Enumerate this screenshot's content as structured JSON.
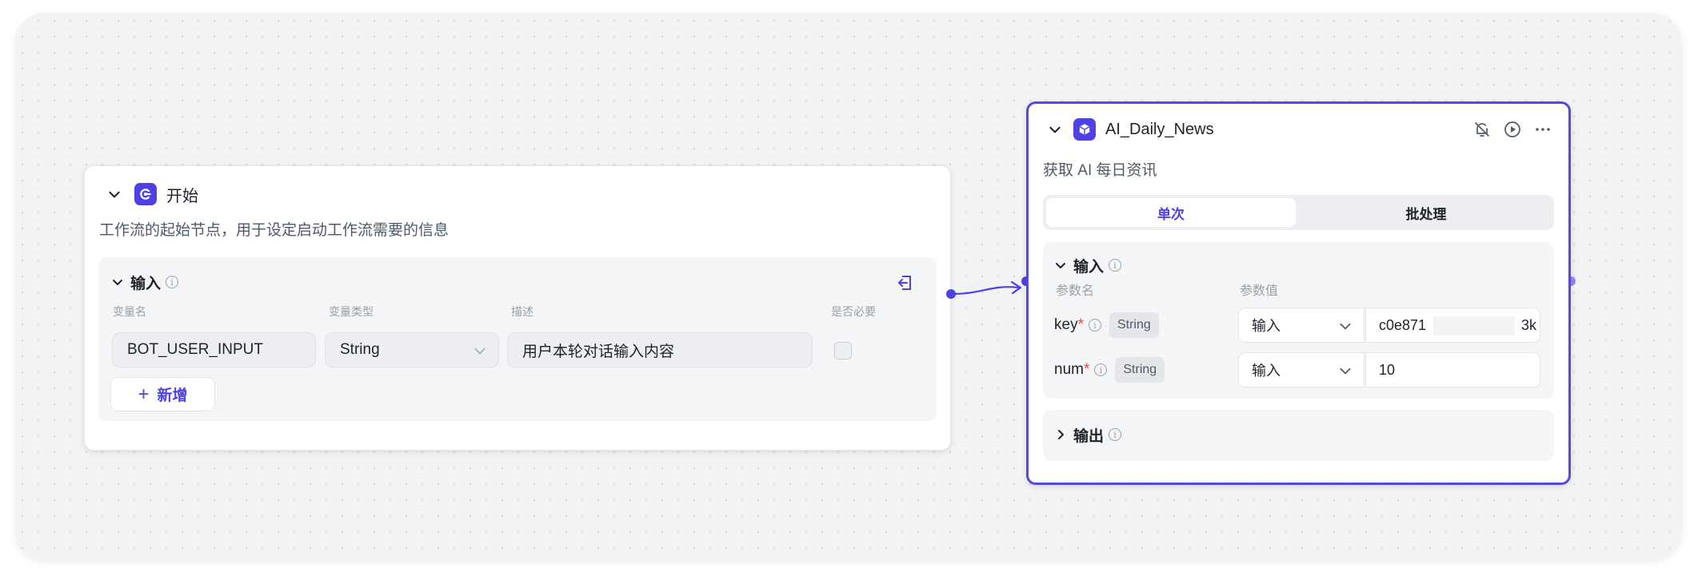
{
  "start_node": {
    "title": "开始",
    "description": "工作流的起始节点，用于设定启动工作流需要的信息",
    "input_section": {
      "title": "输入",
      "columns": [
        "变量名",
        "变量类型",
        "描述",
        "是否必要"
      ],
      "rows": [
        {
          "name": "BOT_USER_INPUT",
          "type": "String",
          "description": "用户本轮对话输入内容",
          "required": false
        }
      ],
      "add_label": "新增"
    }
  },
  "news_node": {
    "title": "AI_Daily_News",
    "description": "获取 AI 每日资讯",
    "tabs": [
      "单次",
      "批处理"
    ],
    "active_tab": "单次",
    "input_section": {
      "title": "输入",
      "columns": [
        "参数名",
        "参数值"
      ],
      "params": [
        {
          "name": "key",
          "required_mark": "*",
          "type": "String",
          "source": "输入",
          "value": "c0e871",
          "value_tail": "3k"
        },
        {
          "name": "num",
          "required_mark": "*",
          "type": "String",
          "source": "输入",
          "value": "10"
        }
      ]
    },
    "output_section": {
      "title": "输出"
    }
  },
  "colors": {
    "accent": "#4e40e5",
    "selected_border": "#5847e8",
    "required": "#f53f3f"
  },
  "icons": [
    "chevron-down-icon",
    "start-node-icon",
    "info-icon",
    "exit-variable-icon",
    "plugin-cube-icon",
    "bell-off-icon",
    "play-circle-icon",
    "more-icon",
    "chevron-right-icon"
  ]
}
